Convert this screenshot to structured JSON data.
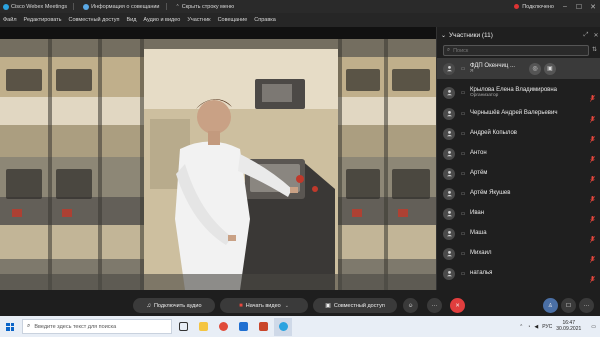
{
  "titlebar": {
    "app_name": "Cisco Webex Meetings",
    "meeting_info": "Информация о совещании",
    "hide_menu": "Скрыть строку меню",
    "status": "Подключено"
  },
  "menu": {
    "items": [
      "Файл",
      "Редактировать",
      "Совместный доступ",
      "Вид",
      "Аудио и видео",
      "Участник",
      "Совещание",
      "Справка"
    ]
  },
  "participants_panel": {
    "title": "Участники (11)",
    "search_placeholder": "Поиск",
    "participants": [
      {
        "name": "ФДП Окенчиц ...",
        "role": "Я",
        "self": true
      },
      {
        "name": "Крылова Елена Владимировна",
        "role": "Организатор"
      },
      {
        "name": "Чернышёв Андрей Валерьевич",
        "role": ""
      },
      {
        "name": "Андрей Копылов",
        "role": ""
      },
      {
        "name": "Антон",
        "role": ""
      },
      {
        "name": "Артём",
        "role": ""
      },
      {
        "name": "Артём Якушев",
        "role": ""
      },
      {
        "name": "Иван",
        "role": ""
      },
      {
        "name": "Маша",
        "role": ""
      },
      {
        "name": "Михаил",
        "role": ""
      },
      {
        "name": "наталья",
        "role": ""
      }
    ]
  },
  "controls": {
    "audio": "Подключить аудио",
    "video": "Начать видео",
    "share": "Совместный доступ"
  },
  "taskbar": {
    "search_placeholder": "Введите здесь текст для поиска",
    "language": "РУС",
    "time": "16:47",
    "date": "30.09.2021"
  },
  "colors": {
    "accent": "#2aa3e0",
    "leave": "#e13e3e",
    "mic_muted": "#e8473d",
    "panel_bg": "#1f1f1f"
  }
}
